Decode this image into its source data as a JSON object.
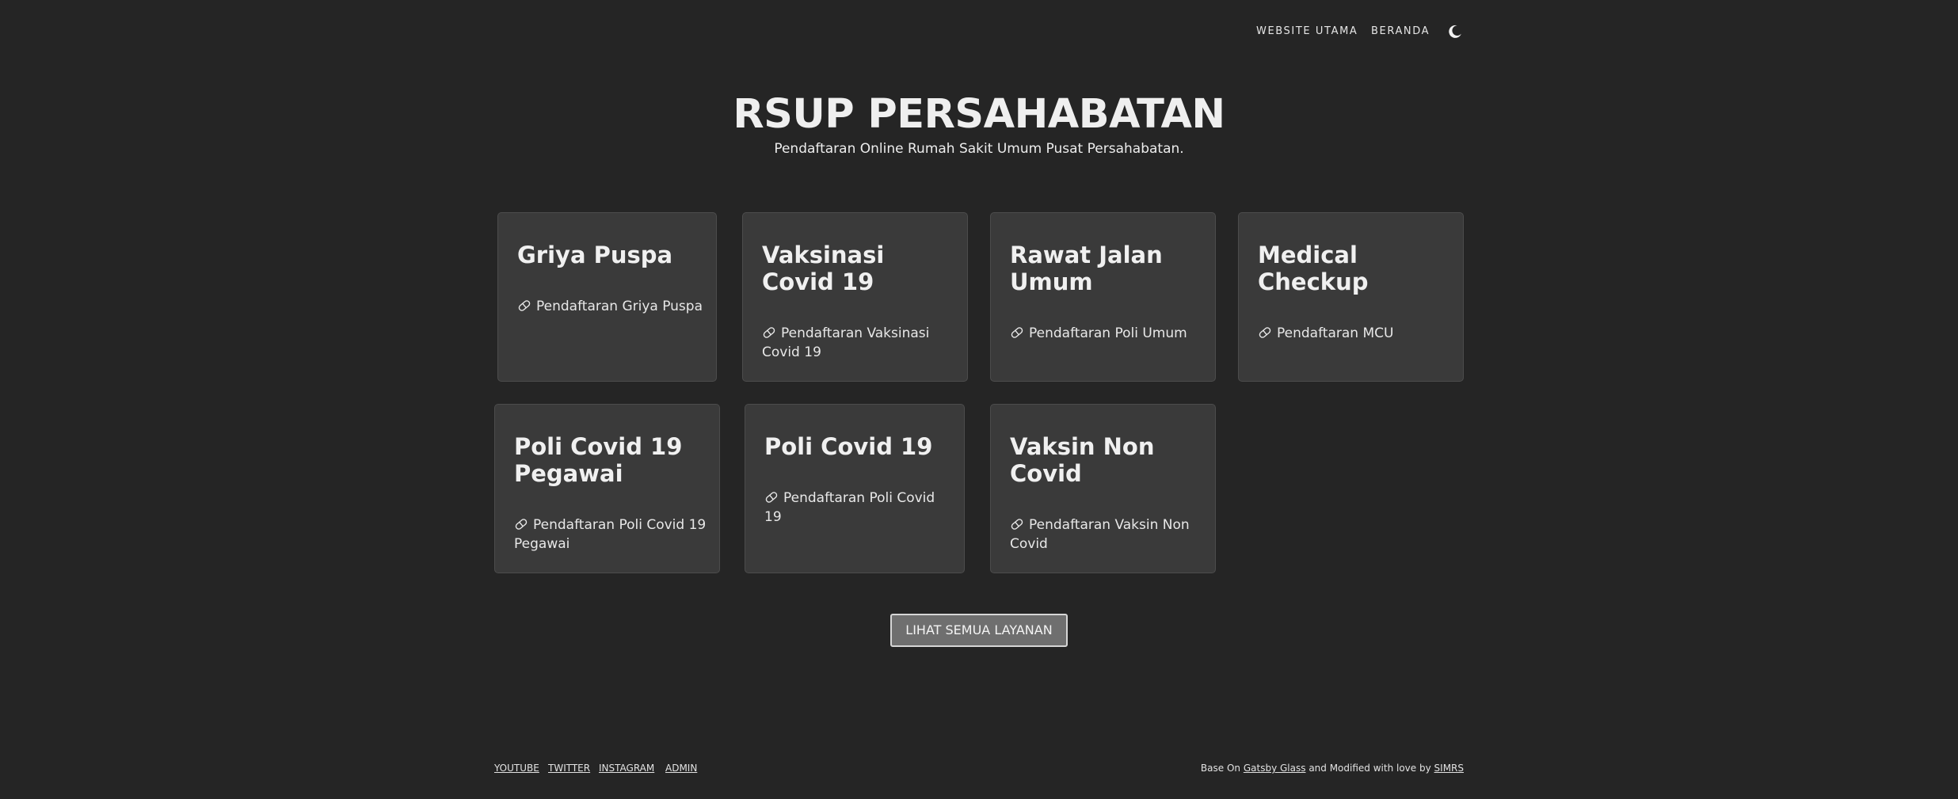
{
  "nav": {
    "links": [
      {
        "label": "WEBSITE UTAMA"
      },
      {
        "label": "BERANDA"
      }
    ],
    "theme_toggle_icon": "moon-icon"
  },
  "hero": {
    "title": "RSUP PERSAHABATAN",
    "subtitle": "Pendaftaran Online Rumah Sakit Umum Pusat Persahabatan."
  },
  "services": [
    {
      "title": "Griya Puspa",
      "link": "Pendaftaran Griya Puspa",
      "icon": "pill-icon"
    },
    {
      "title": "Vaksinasi Covid 19",
      "link": "Pendaftaran Vaksinasi Covid 19",
      "icon": "pill-icon"
    },
    {
      "title": "Rawat Jalan Umum",
      "link": "Pendaftaran Poli Umum",
      "icon": "pill-icon"
    },
    {
      "title": "Medical Checkup",
      "link": "Pendaftaran MCU",
      "icon": "pill-icon"
    },
    {
      "title": "Poli Covid 19 Pegawai",
      "link": "Pendaftaran Poli Covid 19 Pegawai",
      "icon": "pill-icon"
    },
    {
      "title": "Poli Covid 19",
      "link": "Pendaftaran Poli Covid 19",
      "icon": "pill-icon"
    },
    {
      "title": "Vaksin Non Covid",
      "link": "Pendaftaran Vaksin Non Covid",
      "icon": "pill-icon"
    }
  ],
  "cta": {
    "label": "LIHAT SEMUA LAYANAN"
  },
  "footer": {
    "social_links": [
      {
        "label": "YOUTUBE"
      },
      {
        "label": "TWITTER"
      },
      {
        "label": "INSTAGRAM"
      },
      {
        "label": "ADMIN"
      }
    ],
    "credit": {
      "prefix": "Base On",
      "base_link": "Gatsby Glass",
      "middle": "and Modified with love by",
      "author_link": "SIMRS"
    }
  },
  "colors": {
    "background": "#252525",
    "card": "#3a3a3a",
    "card_border": "#4c4c4c",
    "text": "#ededed",
    "button": "#6f6f6f"
  }
}
